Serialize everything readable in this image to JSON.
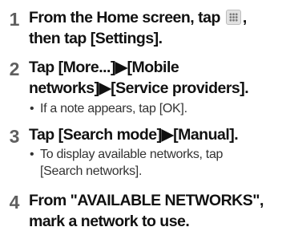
{
  "steps": [
    {
      "number": "1",
      "text_before_icon": "From the Home screen, tap",
      "icon": "apps-grid-icon",
      "text_after_icon": ",",
      "text_line2": "then tap [Settings].",
      "notes": []
    },
    {
      "number": "2",
      "line1": "Tap [More...]▶[Mobile",
      "line2": "networks]▶[Service providers].",
      "notes": [
        "If a note appears, tap [OK]."
      ]
    },
    {
      "number": "3",
      "line1": "Tap [Search mode]▶[Manual].",
      "notes_line1": "To display available networks, tap",
      "notes_line2": "[Search networks]."
    },
    {
      "number": "4",
      "line1": "From \"AVAILABLE NETWORKS\",",
      "line2": "mark a network to use."
    }
  ]
}
